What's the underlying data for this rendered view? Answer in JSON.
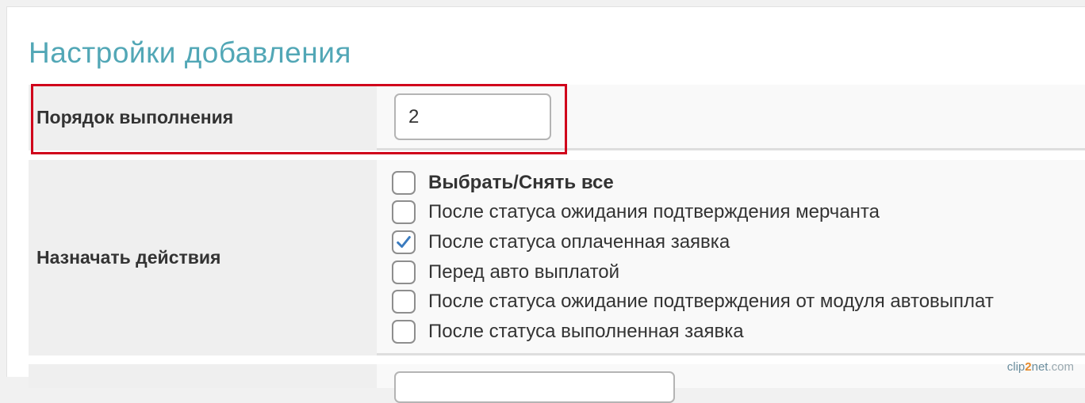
{
  "section": {
    "title": "Настройки добавления"
  },
  "order": {
    "label": "Порядок выполнения",
    "value": "2"
  },
  "actions": {
    "label": "Назначать действия",
    "options": [
      {
        "label": "Выбрать/Снять все",
        "checked": false,
        "bold": true
      },
      {
        "label": "После статуса ожидания подтверждения мерчанта",
        "checked": false,
        "bold": false
      },
      {
        "label": "После статуса оплаченная заявка",
        "checked": true,
        "bold": false
      },
      {
        "label": "Перед авто выплатой",
        "checked": false,
        "bold": false
      },
      {
        "label": "После статуса ожидание подтверждения от модуля автовыплат",
        "checked": false,
        "bold": false
      },
      {
        "label": "После статуса выполненная заявка",
        "checked": false,
        "bold": false
      }
    ]
  },
  "watermark": {
    "part1": "clip",
    "part2": "2",
    "part3": "net",
    "part4": ".com"
  },
  "colors": {
    "title": "#52a7b6",
    "highlight": "#d0021b",
    "checkmark": "#3a7bbf"
  }
}
